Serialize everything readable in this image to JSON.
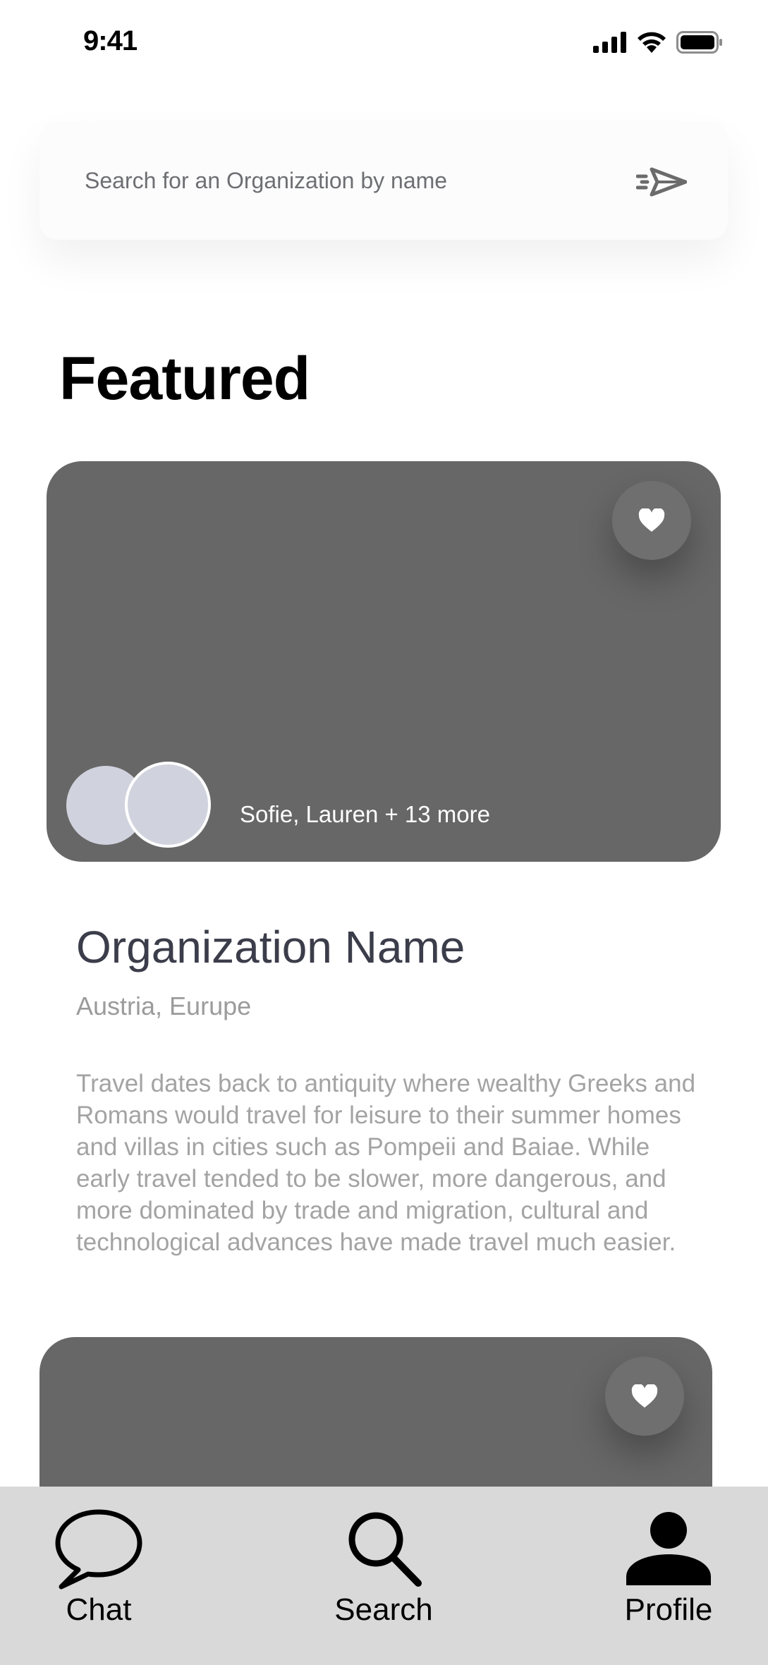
{
  "status_bar": {
    "time": "9:41"
  },
  "search": {
    "placeholder": "Search for an Organization by name"
  },
  "featured": {
    "title": "Featured",
    "card": {
      "members_text": "Sofie, Lauren + 13 more",
      "org_name": "Organization Name",
      "location": "Austria, Eurupe",
      "description": "Travel dates back to antiquity where wealthy Greeks and Romans would travel for leisure to their summer homes and villas in cities such as Pompeii and Baiae. While early travel tended to be slower, more dangerous, and more dominated by trade and migration, cultural and technological advances have made travel much easier."
    }
  },
  "tab_bar": {
    "items": [
      {
        "label": "Chat",
        "icon": "chat-bubble-icon"
      },
      {
        "label": "Search",
        "icon": "magnifier-icon"
      },
      {
        "label": "Profile",
        "icon": "person-icon"
      }
    ]
  },
  "colors": {
    "card": "#676767",
    "avatar": "#d0d3de",
    "tab_bar": "#d9d9d9",
    "org_name": "#3b3d4a",
    "muted_text": "#a3a3a3"
  }
}
